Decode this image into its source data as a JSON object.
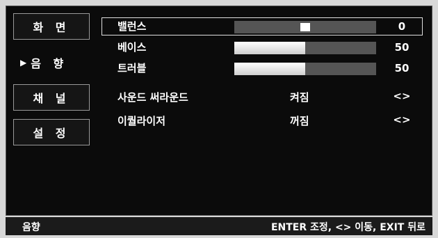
{
  "sidebar": {
    "items": [
      {
        "label": "화 면"
      },
      {
        "label": "음 향",
        "arrow": "▶"
      },
      {
        "label": "채 널"
      },
      {
        "label": "설 정"
      }
    ]
  },
  "settings": {
    "balance": {
      "label": "밸런스",
      "value": "0",
      "level": 0.5
    },
    "bass": {
      "label": "베이스",
      "value": "50",
      "level": 0.5
    },
    "treble": {
      "label": "트러블",
      "value": "50",
      "level": 0.5
    },
    "surround": {
      "label": "사운드 써라운드",
      "state": "켜짐",
      "arrows": "<>"
    },
    "equalizer": {
      "label": "이퀄라이저",
      "state": "꺼짐",
      "arrows": "<>"
    }
  },
  "footer": {
    "section": "음향",
    "hint": "ENTER 조정, <> 이동, EXIT 뒤로"
  }
}
